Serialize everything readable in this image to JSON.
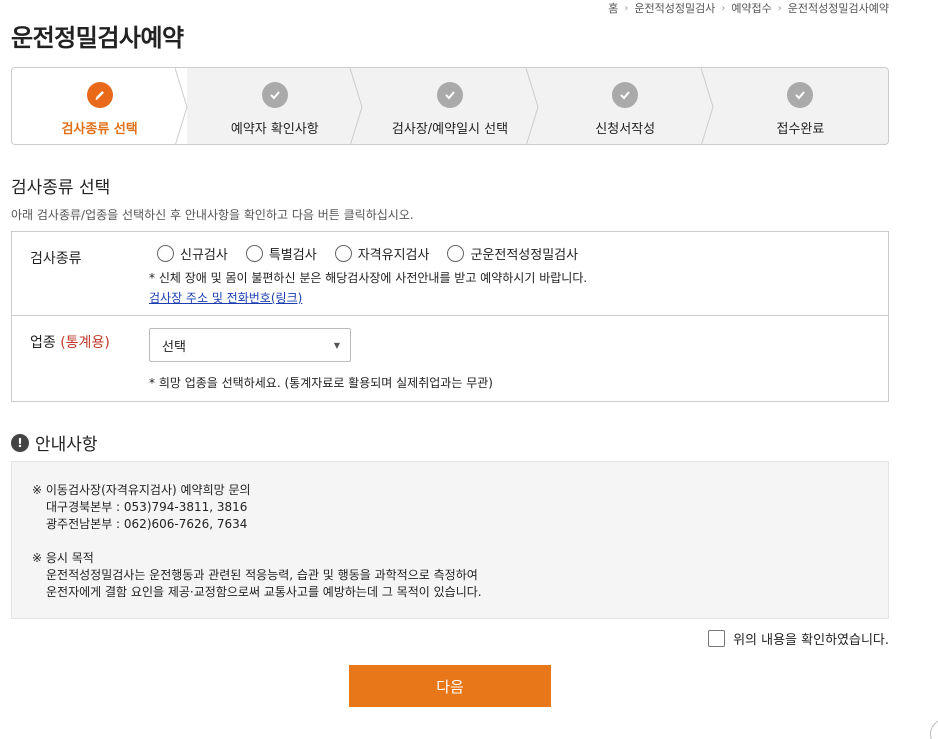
{
  "breadcrumb": [
    "홈",
    "운전적성정밀검사",
    "예약접수",
    "운전적성정밀검사예약"
  ],
  "page_title": "운전정밀검사예약",
  "steps": [
    {
      "label": "검사종류 선택",
      "active": true,
      "icon": "pencil-icon"
    },
    {
      "label": "예약자 확인사항",
      "active": false,
      "icon": "check-icon"
    },
    {
      "label": "검사장/예약일시 선택",
      "active": false,
      "icon": "check-icon"
    },
    {
      "label": "신청서작성",
      "active": false,
      "icon": "check-icon"
    },
    {
      "label": "접수완료",
      "active": false,
      "icon": "check-icon"
    }
  ],
  "section": {
    "title": "검사종류 선택",
    "desc": "아래 검사종류/업종을 선택하신 후 안내사항을 확인하고 다음 버튼 클릭하십시오."
  },
  "form": {
    "exam_type": {
      "label": "검사종류",
      "options": [
        "신규검사",
        "특별검사",
        "자격유지검사",
        "군운전적성정밀검사"
      ],
      "note": "* 신체 장애 및 몸이 불편하신 분은 해당검사장에 사전안내를 받고 예약하시기 바랍니다.",
      "link": "검사장 주소 및 전화번호(링크)"
    },
    "industry": {
      "label": "업종",
      "label_extra": "(통계용)",
      "select_value": "선택",
      "note": "* 희망 업종을 선택하세요. (통계자료로 활용되며 실제취업과는 무관)"
    }
  },
  "notice": {
    "title": "안내사항",
    "lines": [
      "※ 이동검사장(자격유지검사) 예약희망 문의",
      "대구경북본부 : 053)794-3811, 3816",
      "광주전남본부 : 062)606-7626, 7634",
      "※ 응시 목적",
      "운전적성정밀검사는 운전행동과 관련된 적응능력, 습관 및 행동을 과학적으로 측정하여",
      "운전자에게 결함 요인을 제공·교정함으로써 교통사고를 예방하는데 그 목적이 있습니다."
    ]
  },
  "confirm_label": "위의 내용을 확인하였습니다.",
  "next_button": "다음",
  "colors": {
    "accent": "#e8771a",
    "active_step_text": "#e0721a",
    "link": "#1a3eb0",
    "red": "#c0392b"
  }
}
